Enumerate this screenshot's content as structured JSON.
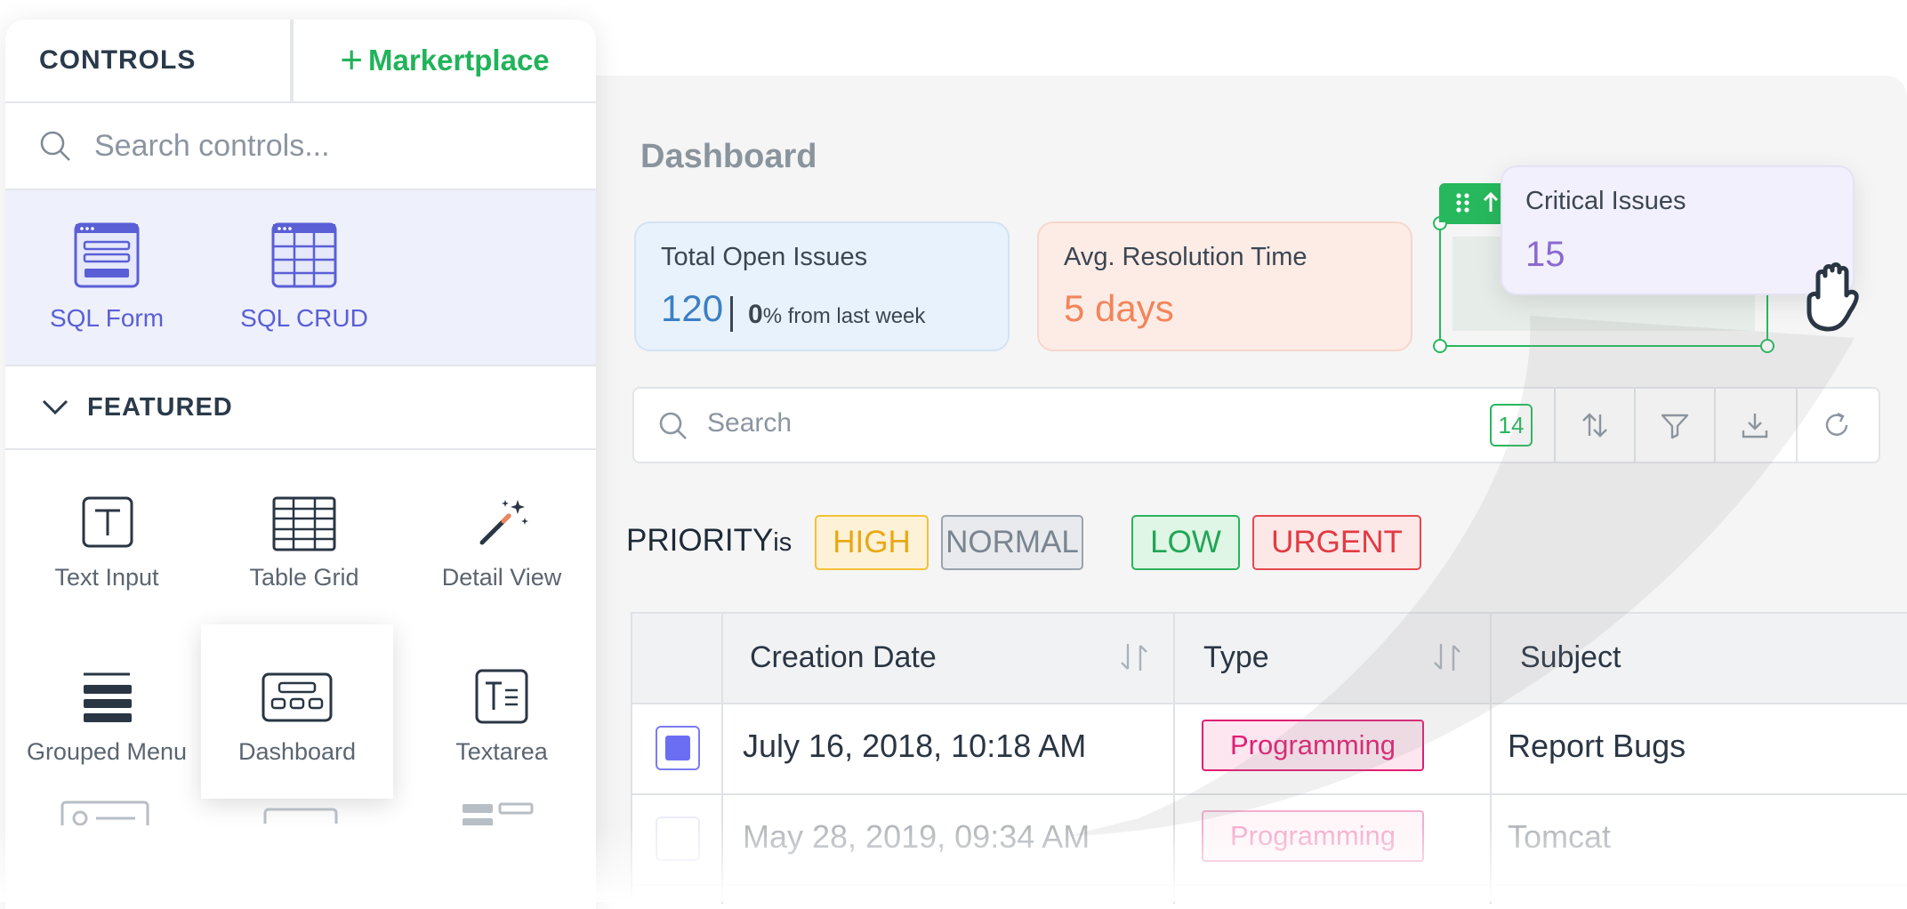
{
  "panel": {
    "tab_controls": "CONTROLS",
    "tab_marketplace": "Markertplace",
    "search_placeholder": "Search controls...",
    "sql_items": [
      {
        "label": "SQL Form",
        "icon": "sql-form-icon"
      },
      {
        "label": "SQL CRUD",
        "icon": "sql-crud-icon"
      }
    ],
    "featured_label": "FEATURED",
    "controls": [
      {
        "label": "Text Input",
        "icon": "text-input-icon"
      },
      {
        "label": "Table Grid",
        "icon": "table-grid-icon"
      },
      {
        "label": "Detail View",
        "icon": "magic-wand-icon"
      },
      {
        "label": "Grouped Menu",
        "icon": "grouped-menu-icon"
      },
      {
        "label": "Dashboard",
        "icon": "dashboard-icon"
      },
      {
        "label": "Textarea",
        "icon": "textarea-icon"
      }
    ]
  },
  "dashboard": {
    "title": "Dashboard",
    "cards": [
      {
        "title": "Total Open Issues",
        "value": "120",
        "delta_value": "0",
        "delta_text": "% from last week"
      },
      {
        "title": "Avg. Resolution Time",
        "value": "5 days"
      }
    ],
    "dragged_card": {
      "title": "Critical Issues",
      "value": "15"
    }
  },
  "table_toolbar": {
    "search_placeholder": "Search",
    "count": "14"
  },
  "filter": {
    "field": "PRIORITY",
    "operator": "is",
    "chips": [
      "HIGH",
      "NORMAL",
      "LOW",
      "URGENT"
    ]
  },
  "table": {
    "columns": [
      "Creation Date",
      "Type",
      "Subject"
    ],
    "rows": [
      {
        "date": "July 16, 2018, 10:18 AM",
        "type": "Programming",
        "subject": "Report Bugs",
        "checked": true
      },
      {
        "date": "May 28, 2019, 09:34 AM",
        "type": "Programming",
        "subject": "Tomcat",
        "checked": false
      }
    ]
  },
  "colors": {
    "accent_green": "#27b85d",
    "accent_purple": "#5a5fd6",
    "tag_pink": "#e01e73"
  }
}
